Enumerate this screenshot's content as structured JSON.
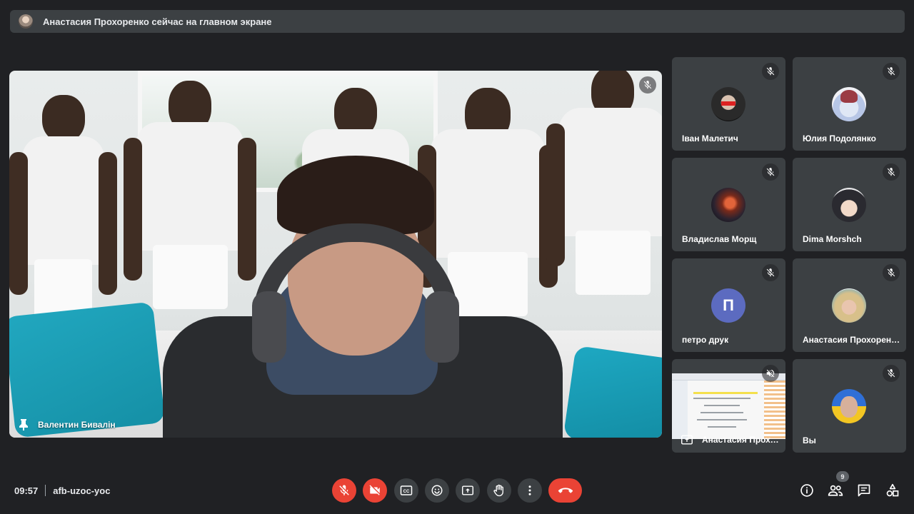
{
  "banner": {
    "text": "Анастасия Прохоренко сейчас на главном экране"
  },
  "main_video": {
    "name": "Валентин Бивалін"
  },
  "tiles": [
    {
      "name": "Іван Малетич",
      "muted": true
    },
    {
      "name": "Юлия Подолянко",
      "muted": true
    },
    {
      "name": "Владислав Морщ",
      "muted": true
    },
    {
      "name": "Dima Morshch",
      "muted": true
    },
    {
      "name": "петро друк",
      "avatar_letter": "П",
      "avatar_color": "#5c6bc0",
      "muted": true
    },
    {
      "name": "Анастасия Прохоренко",
      "muted": true
    },
    {
      "name": "Анастасия Прохоренко",
      "presenting": true,
      "muted": true
    },
    {
      "name": "Вы",
      "muted": true
    }
  ],
  "bottom_bar": {
    "time": "09:57",
    "meeting_code": "afb-uzoc-yoc",
    "participants_count": "9"
  },
  "colors": {
    "background": "#202124",
    "tile": "#3c4043",
    "danger": "#ea4335"
  },
  "icons": [
    "pin-icon",
    "mic-off-icon",
    "camera-off-icon",
    "captions-icon",
    "emoji-icon",
    "present-icon",
    "raise-hand-icon",
    "more-icon",
    "end-call-icon",
    "info-icon",
    "people-icon",
    "chat-icon",
    "activities-icon"
  ]
}
